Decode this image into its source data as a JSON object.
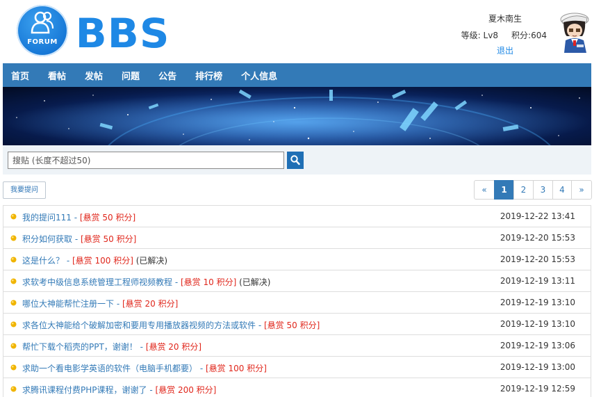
{
  "header": {
    "logo_text": "FORUM",
    "brand": "BBS",
    "user": {
      "name": "夏木南生",
      "level_label": "等级:",
      "level": "Lv8",
      "points_label": "积分:",
      "points": "604",
      "logout": "退出"
    }
  },
  "nav": {
    "items": [
      {
        "label": "首页"
      },
      {
        "label": "看帖"
      },
      {
        "label": "发帖"
      },
      {
        "label": "问题"
      },
      {
        "label": "公告"
      },
      {
        "label": "排行榜"
      },
      {
        "label": "个人信息"
      }
    ]
  },
  "search": {
    "placeholder": "搜贴 (长度不超过50)"
  },
  "toolbar": {
    "ask_label": "我要提问"
  },
  "pager": {
    "prev": "«",
    "pages": [
      "1",
      "2",
      "3",
      "4"
    ],
    "next": "»",
    "current": "1"
  },
  "posts": [
    {
      "title": "我的提问111",
      "reward": "[悬赏 50 积分]",
      "status": "",
      "time": "2019-12-22 13:41"
    },
    {
      "title": "积分如何获取",
      "reward": "[悬赏 50 积分]",
      "status": "",
      "time": "2019-12-20 15:53"
    },
    {
      "title": "这是什么？",
      "reward": "[悬赏 100 积分]",
      "status": "(已解决)",
      "time": "2019-12-20 15:53"
    },
    {
      "title": "求软考中级信息系统管理工程师视频教程",
      "reward": "[悬赏 10 积分]",
      "status": "(已解决)",
      "time": "2019-12-19 13:11"
    },
    {
      "title": "哪位大神能帮忙注册一下",
      "reward": "[悬赏 20 积分]",
      "status": "",
      "time": "2019-12-19 13:10"
    },
    {
      "title": "求各位大神能给个破解加密和要用专用播放器视频的方法或软件",
      "reward": "[悬赏 50 积分]",
      "status": "",
      "time": "2019-12-19 13:10"
    },
    {
      "title": "帮忙下载个稻壳的PPT，谢谢！",
      "reward": "[悬赏 20 积分]",
      "status": "",
      "time": "2019-12-19 13:06"
    },
    {
      "title": "求助一个看电影学英语的软件（电脑手机都要）",
      "reward": "[悬赏 100 积分]",
      "status": "",
      "time": "2019-12-19 13:00"
    },
    {
      "title": "求腾讯课程付费PHP课程，谢谢了",
      "reward": "[悬赏 200 积分]",
      "status": "",
      "time": "2019-12-19 12:59"
    }
  ],
  "colors": {
    "brand": "#1e88e5",
    "nav_bg": "#337ab7",
    "reward": "#e0261b",
    "link": "#337ab7"
  }
}
